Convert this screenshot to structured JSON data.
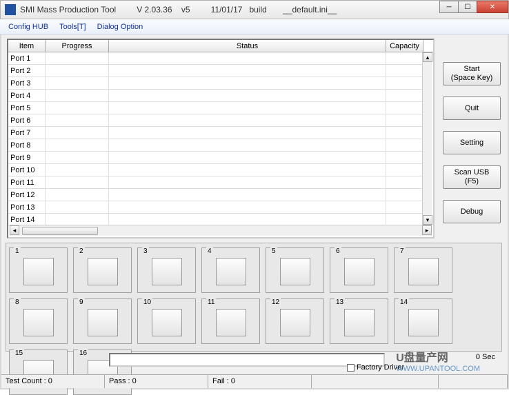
{
  "title": {
    "app": "SMI Mass Production Tool",
    "version": "V 2.03.36",
    "sub": "v5",
    "date": "11/01/17",
    "build": "build",
    "config": "__default.ini__"
  },
  "menu": {
    "config_hub": "Config HUB",
    "tools": "Tools[T]",
    "dialog_option": "Dialog Option"
  },
  "grid": {
    "headers": {
      "item": "Item",
      "progress": "Progress",
      "status": "Status",
      "capacity": "Capacity"
    },
    "rows": [
      {
        "item": "Port 1",
        "progress": "",
        "status": "",
        "capacity": ""
      },
      {
        "item": "Port 2",
        "progress": "",
        "status": "",
        "capacity": ""
      },
      {
        "item": "Port 3",
        "progress": "",
        "status": "",
        "capacity": ""
      },
      {
        "item": "Port 4",
        "progress": "",
        "status": "",
        "capacity": ""
      },
      {
        "item": "Port 5",
        "progress": "",
        "status": "",
        "capacity": ""
      },
      {
        "item": "Port 6",
        "progress": "",
        "status": "",
        "capacity": ""
      },
      {
        "item": "Port 7",
        "progress": "",
        "status": "",
        "capacity": ""
      },
      {
        "item": "Port 8",
        "progress": "",
        "status": "",
        "capacity": ""
      },
      {
        "item": "Port 9",
        "progress": "",
        "status": "",
        "capacity": ""
      },
      {
        "item": "Port 10",
        "progress": "",
        "status": "",
        "capacity": ""
      },
      {
        "item": "Port 11",
        "progress": "",
        "status": "",
        "capacity": ""
      },
      {
        "item": "Port 12",
        "progress": "",
        "status": "",
        "capacity": ""
      },
      {
        "item": "Port 13",
        "progress": "",
        "status": "",
        "capacity": ""
      },
      {
        "item": "Port 14",
        "progress": "",
        "status": "",
        "capacity": ""
      }
    ]
  },
  "buttons": {
    "start_line1": "Start",
    "start_line2": "(Space Key)",
    "quit": "Quit",
    "setting": "Setting",
    "scan_line1": "Scan USB",
    "scan_line2": "(F5)",
    "debug": "Debug"
  },
  "ports": [
    "1",
    "2",
    "3",
    "4",
    "5",
    "6",
    "7",
    "8",
    "9",
    "10",
    "11",
    "12",
    "13",
    "14",
    "15",
    "16"
  ],
  "timer": "0 Sec",
  "checkbox_label": "Factory Driver",
  "status": {
    "test_count": "Test Count : 0",
    "pass": "Pass : 0",
    "fail": "Fail : 0"
  },
  "watermark": {
    "cn": "U盘量产网",
    "url": "WWW.UPANTOOL.COM"
  }
}
